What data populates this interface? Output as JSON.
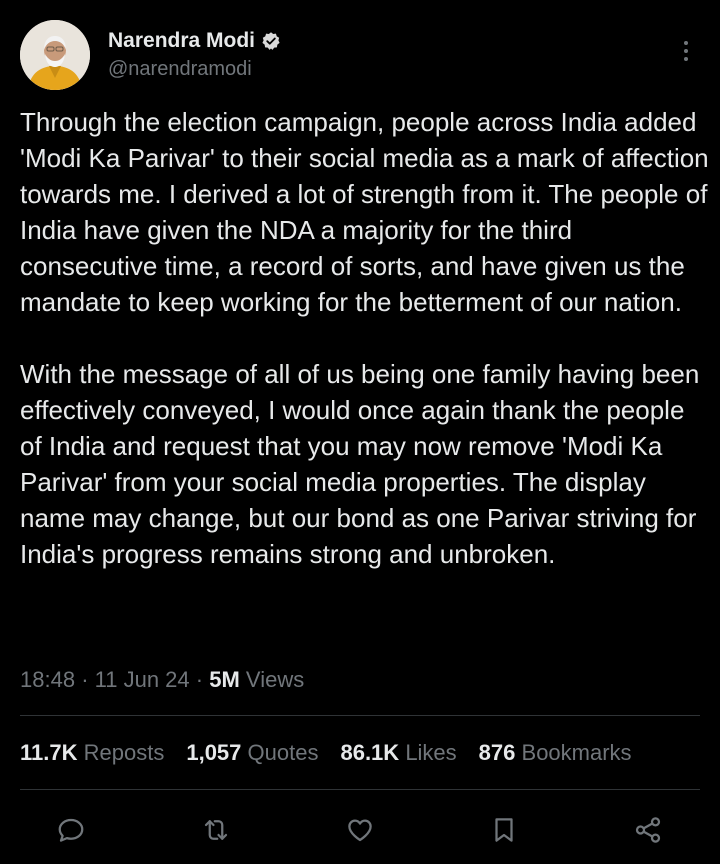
{
  "author": {
    "name": "Narendra Modi",
    "handle": "@narendramodi",
    "verified": true
  },
  "tweet": {
    "paragraphs": [
      "Through the election campaign, people across India added 'Modi Ka Parivar' to their social media as a mark of affection towards me. I derived a lot of strength from it. The people of India have given the NDA a majority for the third consecutive time, a record of sorts, and have given us the mandate to keep working for the betterment of our nation.",
      "With the message of all of us being one family having been effectively conveyed, I would once again thank the people of India and request that you may now remove 'Modi Ka Parivar' from your social media properties. The display name may change, but our bond as one Parivar striving for India's progress remains strong and unbroken."
    ]
  },
  "meta": {
    "time": "18:48",
    "date": "11 Jun 24",
    "views_count": "5M",
    "views_label": "Views"
  },
  "stats": {
    "reposts": {
      "count": "11.7K",
      "label": "Reposts"
    },
    "quotes": {
      "count": "1,057",
      "label": "Quotes"
    },
    "likes": {
      "count": "86.1K",
      "label": "Likes"
    },
    "bookmarks": {
      "count": "876",
      "label": "Bookmarks"
    }
  },
  "actions": [
    "reply-icon",
    "repost-icon",
    "like-icon",
    "bookmark-icon",
    "share-icon"
  ],
  "colors": {
    "background": "#000000",
    "text": "#e7e9ea",
    "muted": "#71767b",
    "divider": "#2f3336",
    "verified": "#d9d9d9"
  }
}
